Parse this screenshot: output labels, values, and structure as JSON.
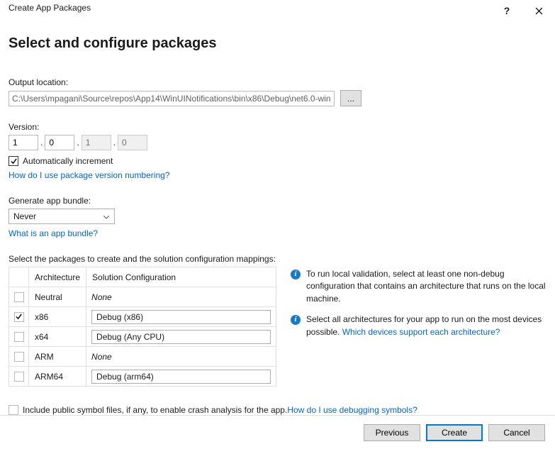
{
  "titlebar": {
    "title": "Create App Packages"
  },
  "page_title": "Select and configure packages",
  "output": {
    "label": "Output location:",
    "path": "C:\\Users\\mpagani\\Source\\repos\\App14\\WinUINotifications\\bin\\x86\\Debug\\net6.0-win",
    "browse_label": "..."
  },
  "version": {
    "label": "Version:",
    "major": "1",
    "minor": "0",
    "build": "1",
    "rev": "0",
    "auto_label": "Automatically increment",
    "help_link": "How do I use package version numbering?"
  },
  "bundle": {
    "label": "Generate app bundle:",
    "value": "Never",
    "help_link": "What is an app bundle?"
  },
  "mapping": {
    "label": "Select the packages to create and the solution configuration mappings:",
    "headers": {
      "arch": "Architecture",
      "cfg": "Solution Configuration"
    },
    "rows": [
      {
        "checked": false,
        "arch": "Neutral",
        "cfg": "None",
        "italic": true
      },
      {
        "checked": true,
        "arch": "x86",
        "cfg": "Debug (x86)",
        "italic": false
      },
      {
        "checked": false,
        "arch": "x64",
        "cfg": "Debug (Any CPU)",
        "italic": false
      },
      {
        "checked": false,
        "arch": "ARM",
        "cfg": "None",
        "italic": true
      },
      {
        "checked": false,
        "arch": "ARM64",
        "cfg": "Debug (arm64)",
        "italic": false
      }
    ]
  },
  "info": {
    "msg1": "To run local validation, select at least one non-debug configuration that contains an architecture that runs on the local machine.",
    "msg2_a": "Select all architectures for your app to run on the most devices possible. ",
    "msg2_link": "Which devices support each architecture?"
  },
  "symbols": {
    "label": "Include public symbol files, if any, to enable crash analysis for the app. ",
    "link": "How do I use debugging symbols?"
  },
  "footer": {
    "previous": "Previous",
    "create": "Create",
    "cancel": "Cancel"
  }
}
